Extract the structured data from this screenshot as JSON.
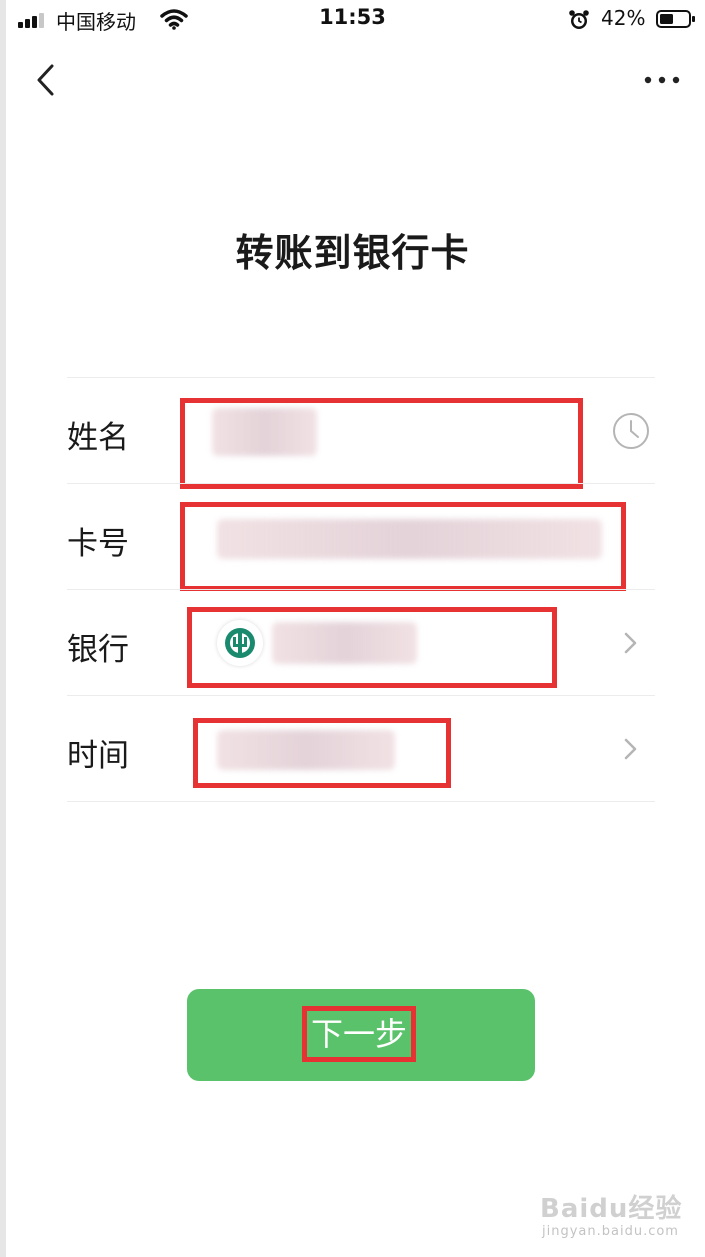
{
  "status_bar": {
    "carrier": "中国移动",
    "time": "11:53",
    "battery": "42%"
  },
  "nav": {
    "back_icon": "chevron-left-icon",
    "more_icon": "ellipsis-icon"
  },
  "page": {
    "title": "转账到银行卡"
  },
  "form": {
    "rows": [
      {
        "label": "姓名",
        "trailing_icon": "clock-history-icon"
      },
      {
        "label": "卡号"
      },
      {
        "label": "银行",
        "trailing_icon": "chevron-right-icon",
        "bank_icon": "abc-bank-logo-icon"
      },
      {
        "label": "时间",
        "trailing_icon": "chevron-right-icon"
      }
    ]
  },
  "next_button": {
    "label": "下一步",
    "color": "#59c26a"
  },
  "watermark": {
    "main": "Baidu经验",
    "sub": "jingyan.baidu.com"
  },
  "colors": {
    "highlight": "#e63232",
    "accent": "#59c26a"
  }
}
